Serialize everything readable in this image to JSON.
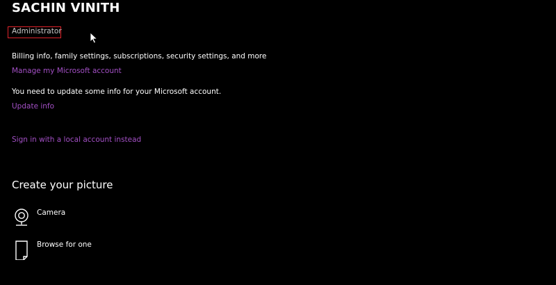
{
  "account": {
    "name": "SACHIN VINITH",
    "role": "Administrator"
  },
  "info": {
    "billing_text": "Billing info, family settings, subscriptions, security settings, and more",
    "manage_link": "Manage my Microsoft account",
    "update_notice": "You need to update some info for your Microsoft account.",
    "update_link": "Update info",
    "local_account_link": "Sign in with a local account instead"
  },
  "picture": {
    "title": "Create your picture",
    "options": [
      {
        "label": "Camera",
        "icon": "camera-icon"
      },
      {
        "label": "Browse for one",
        "icon": "browse-file-icon"
      }
    ]
  },
  "colors": {
    "background": "#000000",
    "link": "#a24fc4",
    "highlight_box": "#e0242b",
    "text": "#ffffff"
  }
}
